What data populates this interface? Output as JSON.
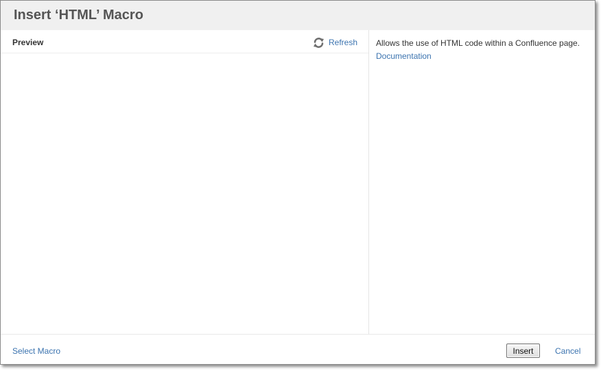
{
  "dialog": {
    "title": "Insert ‘HTML’ Macro"
  },
  "preview": {
    "label": "Preview",
    "refresh_label": "Refresh",
    "refresh_icon": "refresh-icon"
  },
  "info": {
    "description": "Allows the use of HTML code within a Confluence page.",
    "documentation_label": "Documentation"
  },
  "footer": {
    "select_macro_label": "Select Macro",
    "insert_label": "Insert",
    "cancel_label": "Cancel"
  },
  "colors": {
    "link": "#3b73af",
    "header_bg": "#f0f0f0",
    "title_text": "#555555"
  }
}
